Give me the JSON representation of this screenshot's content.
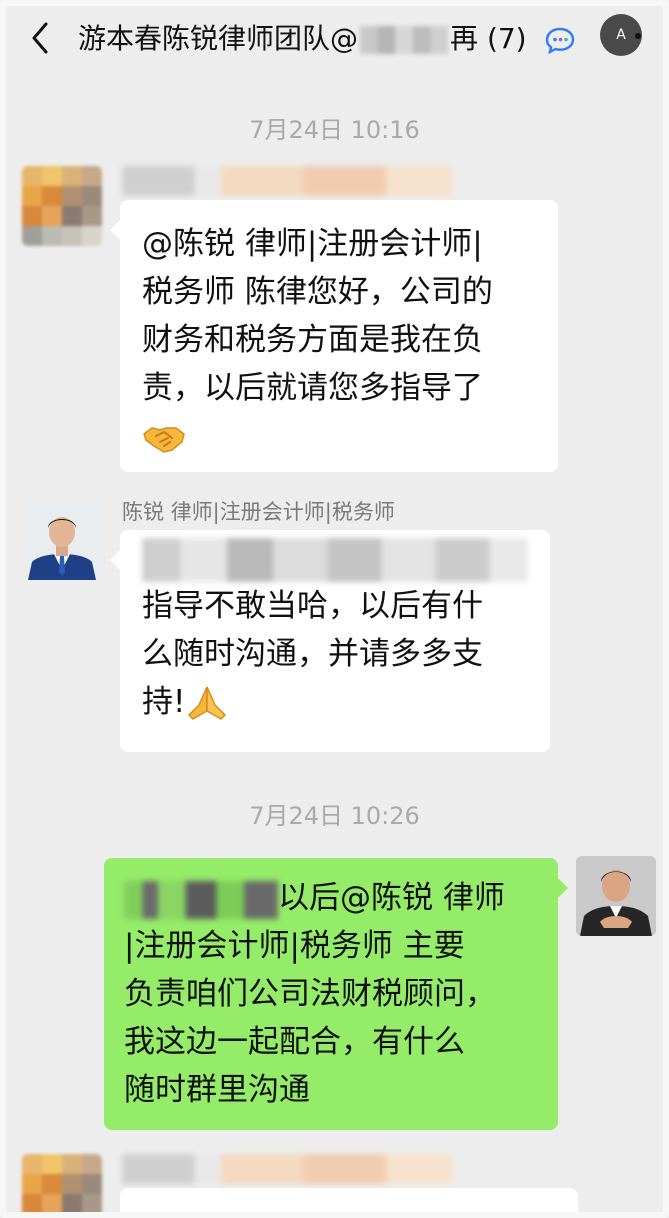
{
  "header": {
    "title_prefix": "游本春陈锐律师团队@",
    "title_suffix": "再",
    "member_count": "(7)",
    "more_icon_glyph": "A"
  },
  "messages": [
    {
      "type": "time",
      "text": "7月24日 10:16"
    },
    {
      "type": "incoming",
      "sender": "",
      "lines": [
        "@陈锐 律师|注册会计师|",
        "税务师 陈律您好，公司的",
        "财务和税务方面是我在负",
        "责，以后就请您多指导了"
      ],
      "emoji": "handshake-emoji"
    },
    {
      "type": "incoming",
      "sender": "陈锐 律师|注册会计师|税务师",
      "lines": [
        "指导不敢当哈，以后有什",
        "么随时沟通，并请多多支",
        "持!"
      ],
      "emoji": "folded-hands-emoji"
    },
    {
      "type": "time",
      "text": "7月24日 10:26"
    },
    {
      "type": "outgoing",
      "first_line_tail": "以后@陈锐 律师",
      "lines": [
        "|注册会计师|税务师 主要",
        "负责咱们公司法财税顾问，",
        "我这边一起配合，有什么",
        "随时群里沟通"
      ]
    }
  ],
  "colors": {
    "background": "#ededed",
    "outgoing_bubble": "#95ec69",
    "incoming_bubble": "#ffffff",
    "timestamp": "#a9a9a9"
  }
}
